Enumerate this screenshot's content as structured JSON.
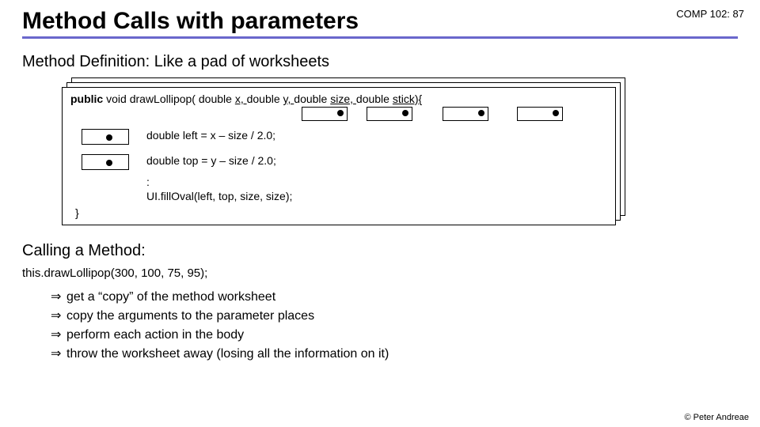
{
  "header": {
    "course": "COMP 102: 87"
  },
  "title": "Method Calls with parameters",
  "section1": "Method Definition:  Like a pad of worksheets",
  "code": {
    "sig_pre": "public",
    "sig_void": " void ",
    "sig_name": "drawLollipop( ",
    "sig_p1t": "double ",
    "sig_p1n": "x, ",
    "sig_p2t": "double ",
    "sig_p2n": "y, ",
    "sig_p3t": "double ",
    "sig_p3n": "size, ",
    "sig_p4t": "double ",
    "sig_p4n": "stick){",
    "l1a": "double",
    "l1b": " left  =   x – size / 2.0;",
    "l2a": "double",
    "l2b": " top  =   y – size / 2.0;",
    "colon": "   :",
    "l3": "UI.fillOval(left, top, size, size);",
    "close": "}"
  },
  "section2": "Calling a Method:",
  "call": "this.drawLollipop(300, 100, 75, 95);",
  "steps": {
    "s1": "get a “copy” of the method worksheet",
    "s2": "copy the arguments to the parameter places",
    "s3": "perform each action in the body",
    "s4": "throw the worksheet away (losing all the information on it)"
  },
  "arrow": "⇒",
  "footer": "© Peter Andreae"
}
